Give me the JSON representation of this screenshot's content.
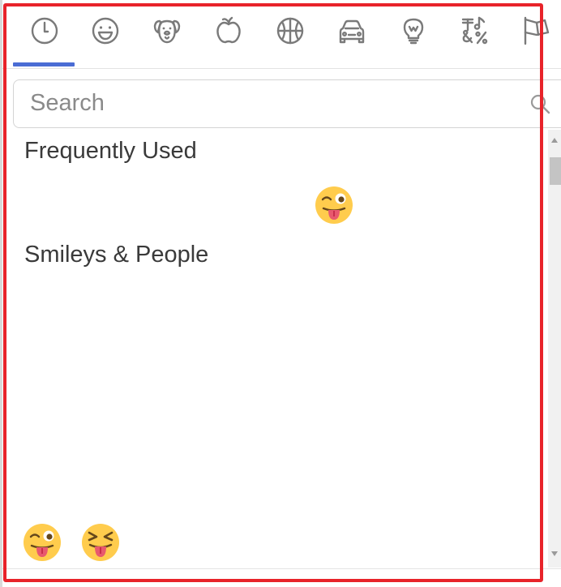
{
  "tabs": [
    {
      "icon": "clock-icon",
      "label": "Frequently Used",
      "selected": true
    },
    {
      "icon": "smiley-icon",
      "label": "Smileys & People",
      "selected": false
    },
    {
      "icon": "dog-icon",
      "label": "Animals & Nature",
      "selected": false
    },
    {
      "icon": "apple-icon",
      "label": "Food & Drink",
      "selected": false
    },
    {
      "icon": "basketball-icon",
      "label": "Activity",
      "selected": false
    },
    {
      "icon": "car-icon",
      "label": "Travel & Places",
      "selected": false
    },
    {
      "icon": "lightbulb-icon",
      "label": "Objects",
      "selected": false
    },
    {
      "icon": "symbols-icon",
      "label": "Symbols",
      "selected": false
    },
    {
      "icon": "flag-icon",
      "label": "Flags",
      "selected": false
    }
  ],
  "accent_color": "#4a6cd4",
  "highlight_color": "#e8232a",
  "search": {
    "placeholder": "Search",
    "value": ""
  },
  "sections": [
    {
      "title": "Frequently Used",
      "emojis": [
        "winking-face-with-tongue"
      ]
    },
    {
      "title": "Smileys & People",
      "emojis": [
        "winking-face-with-tongue",
        "squinting-face-with-tongue"
      ]
    }
  ]
}
